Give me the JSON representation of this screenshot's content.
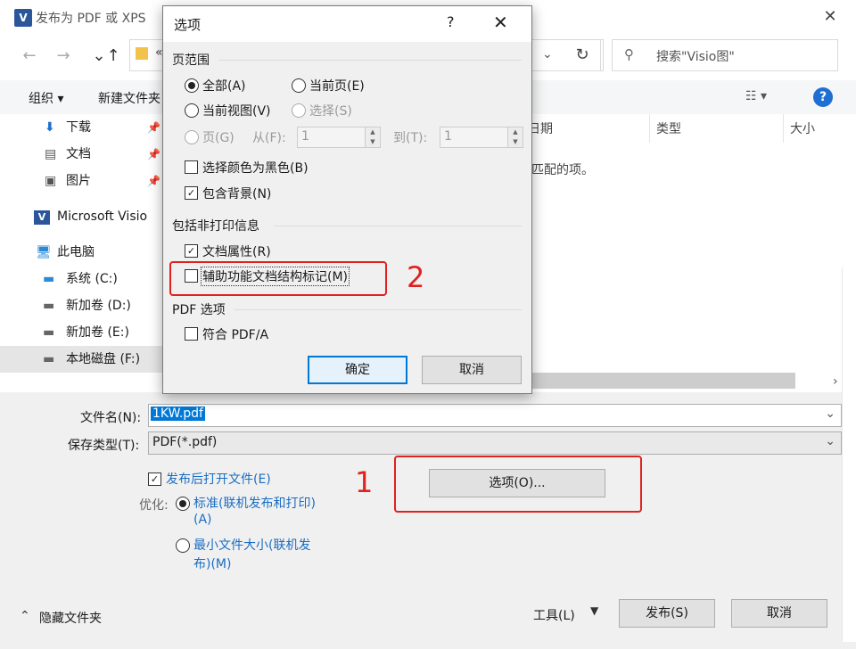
{
  "window": {
    "title": "发布为 PDF 或 XPS",
    "app_icon": "visio-icon",
    "close": "✕"
  },
  "address": {
    "path_prefix": "«"
  },
  "search": {
    "placeholder": "搜索\"Visio图\""
  },
  "toolbar": {
    "organize": "组织 ▾",
    "new_folder": "新建文件夹"
  },
  "sidebar": {
    "items": [
      {
        "label": "下载",
        "icon": "download-icon",
        "pinned": true
      },
      {
        "label": "文档",
        "icon": "document-icon",
        "pinned": true
      },
      {
        "label": "图片",
        "icon": "picture-icon",
        "pinned": true
      },
      {
        "label": "Microsoft Visio",
        "icon": "visio-icon"
      },
      {
        "label": "此电脑",
        "icon": "computer-icon"
      },
      {
        "label": "系统 (C:)",
        "icon": "drive-icon"
      },
      {
        "label": "新加卷 (D:)",
        "icon": "drive-icon"
      },
      {
        "label": "新加卷 (E:)",
        "icon": "drive-icon"
      },
      {
        "label": "本地磁盘 (F:)",
        "icon": "drive-icon",
        "selected": true
      }
    ]
  },
  "columns": {
    "date": "日期",
    "type": "类型",
    "size": "大小"
  },
  "empty_message": "匹配的项。",
  "form": {
    "filename_label": "文件名(N):",
    "filename_value": "1KW.pdf",
    "savetype_label": "保存类型(T):",
    "savetype_value": "PDF(*.pdf)",
    "open_after_publish": "发布后打开文件(E)",
    "optimize_label": "优化:",
    "opt_standard": "标准(联机发布和打印)",
    "opt_standard_key": "(A)",
    "opt_min": "最小文件大小(联机发",
    "opt_min_2": "布)(M)",
    "options_button": "选项(O)...",
    "hide_folders": "隐藏文件夹",
    "tools": "工具(L)",
    "publish": "发布(S)",
    "cancel": "取消"
  },
  "annotations": {
    "label1": "1",
    "label2": "2",
    "color": "#e0211f"
  },
  "dialog": {
    "title": "选项",
    "help": "?",
    "close": "✕",
    "page_range_title": "页范围",
    "all": "全部(A)",
    "current_page": "当前页(E)",
    "current_view": "当前视图(V)",
    "selection": "选择(S)",
    "page": "页(G)",
    "from_label": "从(F):",
    "from_value": "1",
    "to_label": "到(T):",
    "to_value": "1",
    "black_color": "选择颜色为黑色(B)",
    "include_bg": "包含背景(N)",
    "nonprint_title": "包括非打印信息",
    "doc_props": "文档属性(R)",
    "accessibility": "辅助功能文档结构标记(M)",
    "pdf_title": "PDF 选项",
    "pdfa": "符合 PDF/A",
    "ok": "确定",
    "cancel": "取消"
  }
}
